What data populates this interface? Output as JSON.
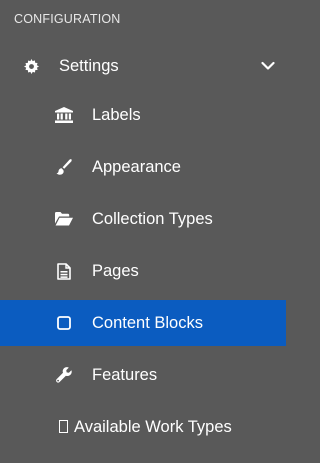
{
  "section": {
    "heading": "CONFIGURATION"
  },
  "settings": {
    "label": "Settings"
  },
  "items": [
    {
      "label": "Labels",
      "icon": "bank-icon"
    },
    {
      "label": "Appearance",
      "icon": "paintbrush-icon"
    },
    {
      "label": "Collection Types",
      "icon": "folder-open-icon"
    },
    {
      "label": "Pages",
      "icon": "file-text-icon"
    },
    {
      "label": "Content Blocks",
      "icon": "square-outline-icon",
      "active": true
    },
    {
      "label": "Features",
      "icon": "wrench-icon"
    },
    {
      "label": "Available Work Types",
      "icon": "missing-glyph-icon"
    }
  ],
  "colors": {
    "background": "#595959",
    "active": "#0b5cc0",
    "text": "#ffffff"
  }
}
